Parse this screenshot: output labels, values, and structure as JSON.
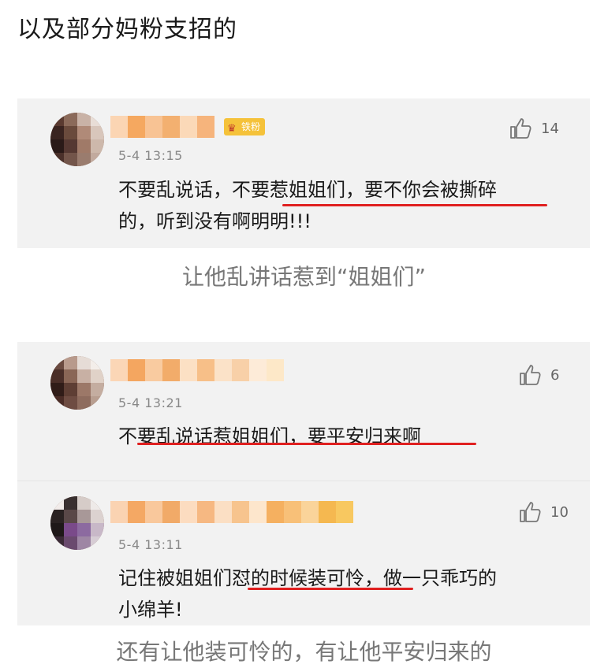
{
  "heading": "以及部分妈粉支招的",
  "captions": {
    "first": "让他乱讲话惹到“姐姐们”",
    "second": "还有让他装可怜的，有让他平安归来的"
  },
  "comments": [
    {
      "badge": "铁粉",
      "time": "5-4 13:15",
      "likes": "14",
      "line1": "不要乱说话，不要惹姐姐们，要不你会被撕碎",
      "line2": "的，听到没有啊明明!!!"
    },
    {
      "time": "5-4 13:21",
      "likes": "6",
      "line1": "不要乱说话惹姐姐们，要平安归来啊"
    },
    {
      "time": "5-4 13:11",
      "likes": "10",
      "line1": "记住被姐姐们怼的时候装可怜，做一只乖巧的",
      "line2": "小绵羊!"
    }
  ],
  "colors": {
    "underline": "#e02020",
    "badge": "#f5c23a",
    "card_bg": "#f2f2f2",
    "blur_orange": "#f5a860"
  },
  "icons": [
    "thumbs-up-icon",
    "crown-icon"
  ]
}
